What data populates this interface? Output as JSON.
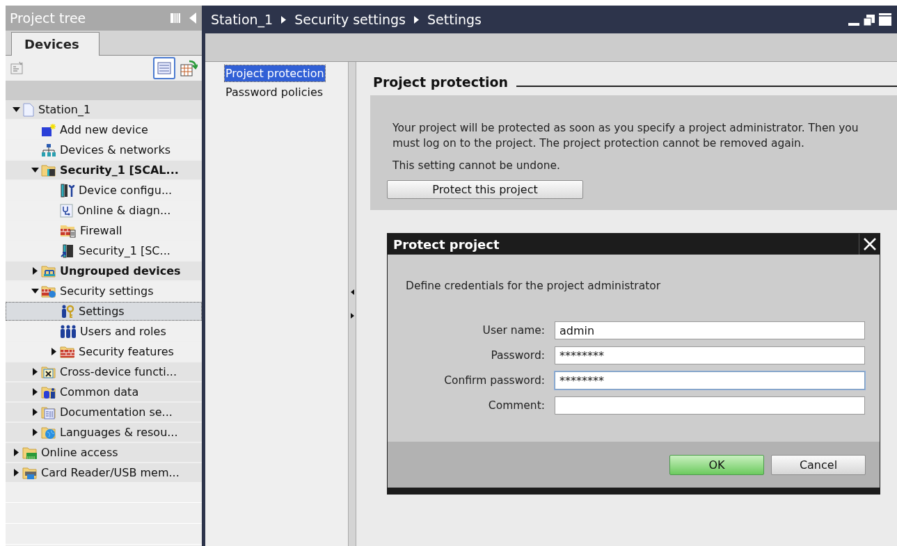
{
  "project_tree": {
    "title": "Project tree",
    "tabs": [
      {
        "label": "Devices",
        "selected": true
      }
    ],
    "items": [
      {
        "label": "Station_1",
        "kind": "document",
        "expanded": true,
        "shaded": true,
        "selected": false,
        "children": [
          {
            "label": "Add new device",
            "kind": "add",
            "shaded": false,
            "selected": false
          },
          {
            "label": "Devices & networks",
            "kind": "network",
            "shaded": false,
            "selected": false
          },
          {
            "label": "Security_1 [SCAL...",
            "kind": "folder-device",
            "bold": true,
            "expanded": true,
            "shaded": true,
            "selected": false,
            "children": [
              {
                "label": "Device configu...",
                "kind": "config",
                "shaded": false,
                "selected": false
              },
              {
                "label": "Online & diagn...",
                "kind": "diagnostics",
                "shaded": false,
                "selected": false
              },
              {
                "label": "Firewall",
                "kind": "firewall",
                "shaded": false,
                "selected": false
              },
              {
                "label": "Security_1 [SC...",
                "kind": "module",
                "shaded": false,
                "selected": false
              }
            ]
          },
          {
            "label": "Ungrouped devices",
            "kind": "folder-network",
            "bold": true,
            "expanded": false,
            "shaded": true,
            "selected": false
          },
          {
            "label": "Security settings",
            "kind": "folder-security",
            "expanded": true,
            "shaded": false,
            "selected": false,
            "children": [
              {
                "label": "Settings",
                "kind": "settings",
                "shaded": false,
                "selected": true
              },
              {
                "label": "Users and roles",
                "kind": "users",
                "shaded": false,
                "selected": false
              },
              {
                "label": "Security features",
                "kind": "wall",
                "expanded": false,
                "shaded": false,
                "selected": false
              }
            ]
          },
          {
            "label": "Cross-device functi...",
            "kind": "folder-cross",
            "expanded": false,
            "shaded": true,
            "selected": false
          },
          {
            "label": "Common data",
            "kind": "folder-data",
            "expanded": false,
            "shaded": true,
            "selected": false
          },
          {
            "label": "Documentation se...",
            "kind": "folder-doc",
            "expanded": false,
            "shaded": true,
            "selected": false
          },
          {
            "label": "Languages & resou...",
            "kind": "folder-globe",
            "expanded": false,
            "shaded": true,
            "selected": false
          }
        ]
      },
      {
        "label": "Online access",
        "kind": "folder-online",
        "expanded": false,
        "shaded": true,
        "selected": false
      },
      {
        "label": "Card Reader/USB mem...",
        "kind": "folder-card",
        "expanded": false,
        "shaded": true,
        "selected": false
      }
    ]
  },
  "breadcrumb": [
    "Station_1",
    "Security settings",
    "Settings"
  ],
  "nav": [
    {
      "label": "Project protection",
      "selected": true
    },
    {
      "label": "Password policies",
      "selected": false
    }
  ],
  "section": {
    "title": "Project protection",
    "paragraphs": [
      "Your project will be protected as soon as you specify a project administrator. Then you must log on to the project. The project protection cannot be removed again.",
      "This setting cannot be undone."
    ],
    "button": "Protect this project"
  },
  "dialog": {
    "title": "Protect project",
    "instruction": "Define credentials for the project administrator",
    "fields": [
      {
        "label": "User name:",
        "value": "admin",
        "focused": false
      },
      {
        "label": "Password:",
        "value": "********",
        "focused": false
      },
      {
        "label": "Confirm password:",
        "value": "********",
        "focused": true
      },
      {
        "label": "Comment:",
        "focused": false
      }
    ],
    "buttons": [
      {
        "label": "OK",
        "kind": "primary"
      },
      {
        "label": "Cancel",
        "kind": "secondary"
      }
    ]
  }
}
